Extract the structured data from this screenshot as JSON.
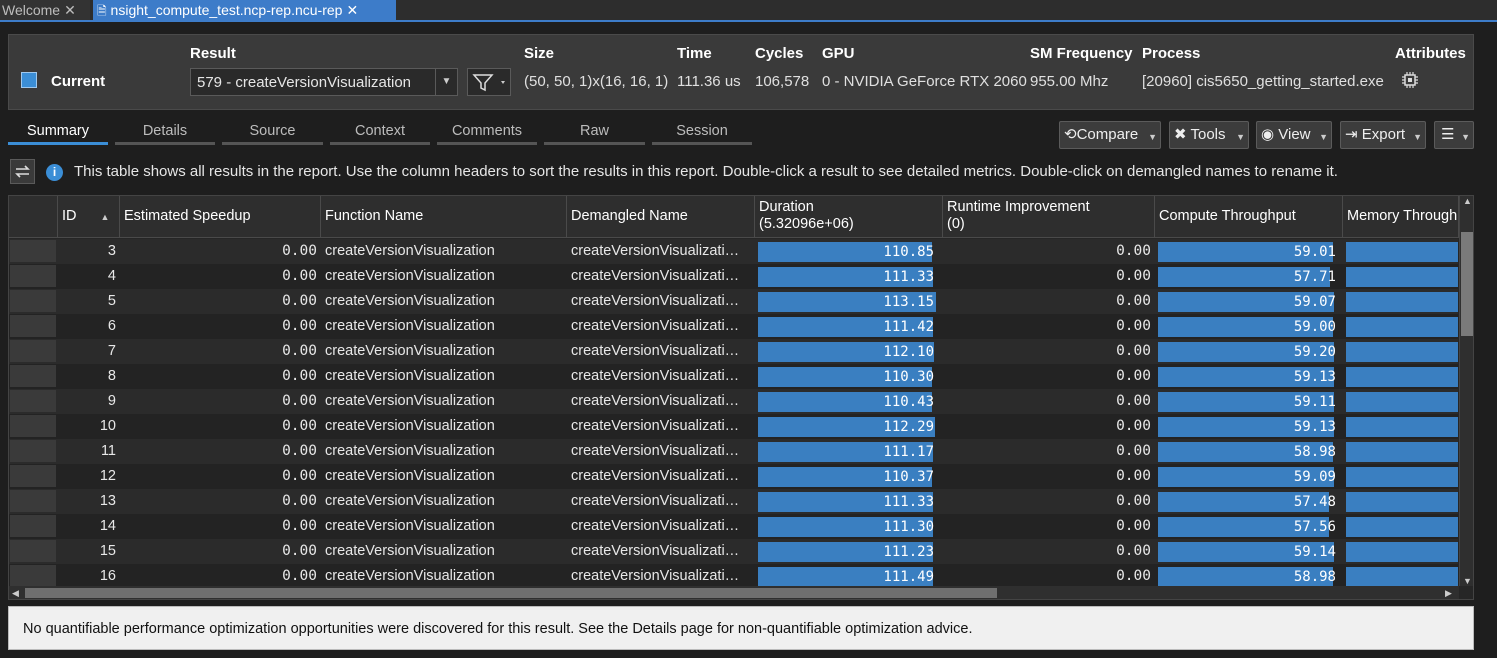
{
  "doc_tabs": [
    {
      "label": "Welcome"
    },
    {
      "label": "nsight_compute_test.ncp-rep.ncu-rep"
    }
  ],
  "header": {
    "current_label": "Current",
    "columns": {
      "result": "Result",
      "size": "Size",
      "time": "Time",
      "cycles": "Cycles",
      "gpu": "GPU",
      "sm_frequency": "SM Frequency",
      "process": "Process",
      "attributes": "Attributes"
    },
    "values": {
      "result": "579 - createVersionVisualization",
      "size": "(50, 50, 1)x(16, 16, 1)",
      "time": "111.36 us",
      "cycles": "106,578",
      "gpu": "0 - NVIDIA GeForce RTX 2060",
      "sm_frequency": "955.00 Mhz",
      "process": "[20960] cis5650_getting_started.exe"
    }
  },
  "view_tabs": [
    "Summary",
    "Details",
    "Source",
    "Context",
    "Comments",
    "Raw",
    "Session"
  ],
  "toolbar": {
    "compare": "Compare",
    "tools": "Tools",
    "view": "View",
    "export": "Export"
  },
  "info_text": "This table shows all results in the report. Use the column headers to sort the results in this report. Double-click a result to see detailed metrics. Double-click on demangled names to rename it.",
  "table": {
    "headers": {
      "id": "ID",
      "speedup": "Estimated Speedup",
      "function": "Function Name",
      "demangled": "Demangled Name",
      "duration": "Duration",
      "duration_sub": "(5.32096e+06)",
      "runtime": "Runtime Improvement",
      "runtime_sub": "(0)",
      "compute": "Compute Throughput",
      "memory": "Memory Through"
    },
    "rows": [
      {
        "id": "3",
        "speedup": "0.00",
        "function": "createVersionVisualization",
        "demangled": "createVersionVisualizati…",
        "duration": "110.85",
        "runtime": "0.00",
        "compute": "59.01"
      },
      {
        "id": "4",
        "speedup": "0.00",
        "function": "createVersionVisualization",
        "demangled": "createVersionVisualizati…",
        "duration": "111.33",
        "runtime": "0.00",
        "compute": "57.71"
      },
      {
        "id": "5",
        "speedup": "0.00",
        "function": "createVersionVisualization",
        "demangled": "createVersionVisualizati…",
        "duration": "113.15",
        "runtime": "0.00",
        "compute": "59.07"
      },
      {
        "id": "6",
        "speedup": "0.00",
        "function": "createVersionVisualization",
        "demangled": "createVersionVisualizati…",
        "duration": "111.42",
        "runtime": "0.00",
        "compute": "59.00"
      },
      {
        "id": "7",
        "speedup": "0.00",
        "function": "createVersionVisualization",
        "demangled": "createVersionVisualizati…",
        "duration": "112.10",
        "runtime": "0.00",
        "compute": "59.20"
      },
      {
        "id": "8",
        "speedup": "0.00",
        "function": "createVersionVisualization",
        "demangled": "createVersionVisualizati…",
        "duration": "110.30",
        "runtime": "0.00",
        "compute": "59.13"
      },
      {
        "id": "9",
        "speedup": "0.00",
        "function": "createVersionVisualization",
        "demangled": "createVersionVisualizati…",
        "duration": "110.43",
        "runtime": "0.00",
        "compute": "59.11"
      },
      {
        "id": "10",
        "speedup": "0.00",
        "function": "createVersionVisualization",
        "demangled": "createVersionVisualizati…",
        "duration": "112.29",
        "runtime": "0.00",
        "compute": "59.13"
      },
      {
        "id": "11",
        "speedup": "0.00",
        "function": "createVersionVisualization",
        "demangled": "createVersionVisualizati…",
        "duration": "111.17",
        "runtime": "0.00",
        "compute": "58.98"
      },
      {
        "id": "12",
        "speedup": "0.00",
        "function": "createVersionVisualization",
        "demangled": "createVersionVisualizati…",
        "duration": "110.37",
        "runtime": "0.00",
        "compute": "59.09"
      },
      {
        "id": "13",
        "speedup": "0.00",
        "function": "createVersionVisualization",
        "demangled": "createVersionVisualizati…",
        "duration": "111.33",
        "runtime": "0.00",
        "compute": "57.48"
      },
      {
        "id": "14",
        "speedup": "0.00",
        "function": "createVersionVisualization",
        "demangled": "createVersionVisualizati…",
        "duration": "111.30",
        "runtime": "0.00",
        "compute": "57.56"
      },
      {
        "id": "15",
        "speedup": "0.00",
        "function": "createVersionVisualization",
        "demangled": "createVersionVisualizati…",
        "duration": "111.23",
        "runtime": "0.00",
        "compute": "59.14"
      },
      {
        "id": "16",
        "speedup": "0.00",
        "function": "createVersionVisualization",
        "demangled": "createVersionVisualizati…",
        "duration": "111.49",
        "runtime": "0.00",
        "compute": "58.98"
      }
    ]
  },
  "status_text": "No quantifiable performance optimization opportunities were discovered for this result. See the Details page for non-quantifiable optimization advice.",
  "colors": {
    "accent": "#3b8ed6",
    "bar": "#3a7fc1"
  }
}
